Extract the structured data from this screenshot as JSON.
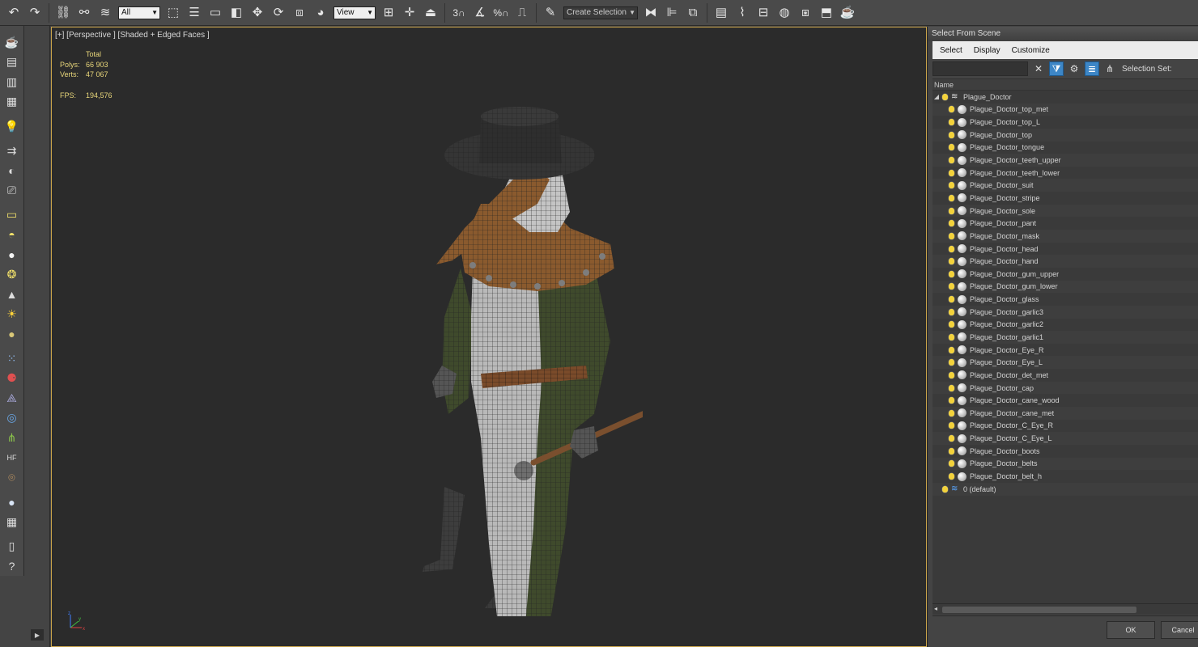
{
  "toolbar": {
    "selection_filter": "All",
    "ref_coord": "View",
    "selection_set": "Create Selection Se"
  },
  "viewport": {
    "label": "[+] [Perspective ] [Shaded + Edged Faces ]",
    "stats": {
      "total_label": "Total",
      "polys_label": "Polys:",
      "polys_value": "66 903",
      "verts_label": "Verts:",
      "verts_value": "47 067",
      "fps_label": "FPS:",
      "fps_value": "194,576"
    },
    "axis": {
      "x": "x",
      "y": "y",
      "z": "z"
    }
  },
  "scene": {
    "title": "Select From Scene",
    "menu": [
      "Select",
      "Display",
      "Customize"
    ],
    "selection_set_label": "Selection Set:",
    "column_name": "Name",
    "root": "Plague_Doctor",
    "children": [
      "Plague_Doctor_top_met",
      "Plague_Doctor_top_L",
      "Plague_Doctor_top",
      "Plague_Doctor_tongue",
      "Plague_Doctor_teeth_upper",
      "Plague_Doctor_teeth_lower",
      "Plague_Doctor_suit",
      "Plague_Doctor_stripe",
      "Plague_Doctor_sole",
      "Plague_Doctor_pant",
      "Plague_Doctor_mask",
      "Plague_Doctor_head",
      "Plague_Doctor_hand",
      "Plague_Doctor_gum_upper",
      "Plague_Doctor_gum_lower",
      "Plague_Doctor_glass",
      "Plague_Doctor_garlic3",
      "Plague_Doctor_garlic2",
      "Plague_Doctor_garlic1",
      "Plague_Doctor_Eye_R",
      "Plague_Doctor_Eye_L",
      "Plague_Doctor_det_met",
      "Plague_Doctor_cap",
      "Plague_Doctor_cane_wood",
      "Plague_Doctor_cane_met",
      "Plague_Doctor_C_Eye_R",
      "Plague_Doctor_C_Eye_L",
      "Plague_Doctor_boots",
      "Plague_Doctor_belts",
      "Plague_Doctor_belt_h"
    ],
    "default_layer": "0 (default)",
    "ok_label": "OK",
    "cancel_label": "Cancel"
  },
  "colors": {
    "viewport_border": "#caa44a",
    "stats_text": "#e8d67a",
    "active_filter": "#3d86c6"
  }
}
